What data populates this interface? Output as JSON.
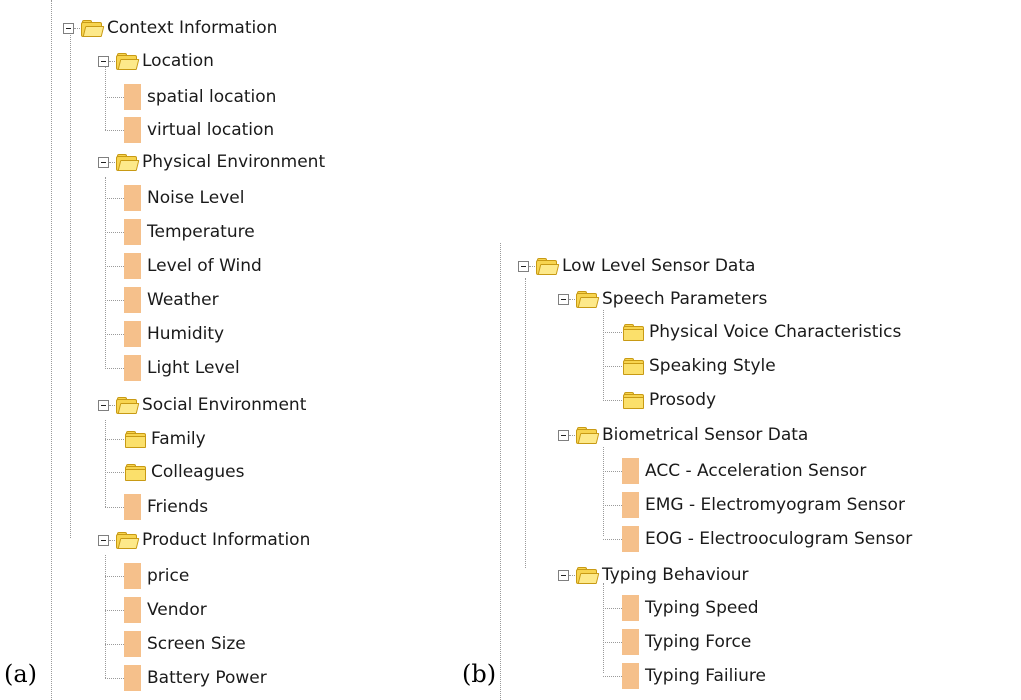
{
  "captions": {
    "a": "(a)",
    "b": "(b)"
  },
  "panel_a": {
    "root": "Context Information",
    "groups": [
      {
        "label": "Location",
        "items": [
          "spatial location",
          "virtual location"
        ]
      },
      {
        "label": "Physical Environment",
        "items": [
          "Noise Level",
          "Temperature",
          "Level of Wind",
          "Weather",
          "Humidity",
          "Light Level"
        ]
      },
      {
        "label": "Social Environment",
        "items": [
          "Family",
          "Colleagues",
          "Friends"
        ]
      },
      {
        "label": "Product Information",
        "items": [
          "price",
          "Vendor",
          "Screen Size",
          "Battery Power"
        ]
      }
    ]
  },
  "panel_b": {
    "root": "Low Level Sensor Data",
    "groups": [
      {
        "label": "Speech Parameters",
        "items": [
          "Physical Voice Characteristics",
          "Speaking Style",
          "Prosody"
        ]
      },
      {
        "label": "Biometrical Sensor Data",
        "items": [
          "ACC - Acceleration Sensor",
          "EMG - Electromyogram Sensor",
          "EOG - Electrooculogram Sensor"
        ]
      },
      {
        "label": "Typing Behaviour",
        "items": [
          "Typing Speed",
          "Typing Force",
          "Typing Failiure"
        ]
      }
    ]
  },
  "icons": {
    "expanded": "collapse-minus-icon",
    "folder_open": "folder-open-icon",
    "folder_closed": "folder-icon",
    "leaf": "leaf-node-icon"
  },
  "colors": {
    "folder": "#f7d44f",
    "leaf": "#f5c08b",
    "connector": "#9a9a9a"
  }
}
